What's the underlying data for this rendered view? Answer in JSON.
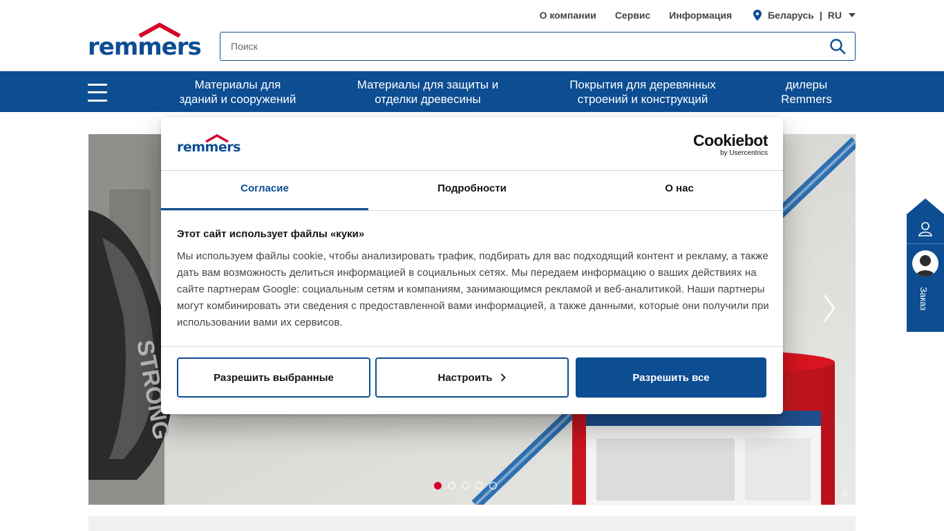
{
  "brand": {
    "logo_text": "remmers"
  },
  "top_links": {
    "about": "О компании",
    "service": "Сервис",
    "info": "Информация",
    "country": "Беларусь",
    "separator": "|",
    "language": "RU"
  },
  "search": {
    "placeholder": "Поиск"
  },
  "nav": {
    "items": [
      {
        "line1": "Материалы для",
        "line2": "зданий и сооружений"
      },
      {
        "line1": "Материалы для защиты и",
        "line2": "отделки древесины"
      },
      {
        "line1": "Покрытия для деревянных",
        "line2": "строений и конструкций"
      },
      {
        "line1": "дилеры",
        "line2": "Remmers"
      }
    ]
  },
  "hero": {
    "copyright": "©",
    "slides": 5,
    "active_slide": 1
  },
  "side_tab": {
    "label": "Заказ"
  },
  "cookie": {
    "logo_text": "remmers",
    "provider": "Cookiebot",
    "provider_sub": "by Usercentrics",
    "tabs": [
      "Согласие",
      "Подробности",
      "О нас"
    ],
    "active_tab": 0,
    "title": "Этот сайт использует файлы «куки»",
    "body": "Мы используем файлы cookie, чтобы анализировать трафик, подбирать для вас подходящий контент и рекламу, а также дать вам возможность делиться информацией в социальных сетях. Мы передаем информацию о ваших действиях на сайте партнерам Google: социальным сетям и компаниям, занимающимся рекламой и веб-аналитикой. Наши партнеры могут комбинировать эти сведения с предоставленной вами информацией, а также данными, которые они получили при использовании вами их сервисов.",
    "buttons": {
      "allow_selected": "Разрешить выбранные",
      "customize": "Настроить",
      "allow_all": "Разрешить все"
    }
  },
  "colors": {
    "brand_blue": "#0d4d92",
    "brand_red": "#d4002a"
  }
}
